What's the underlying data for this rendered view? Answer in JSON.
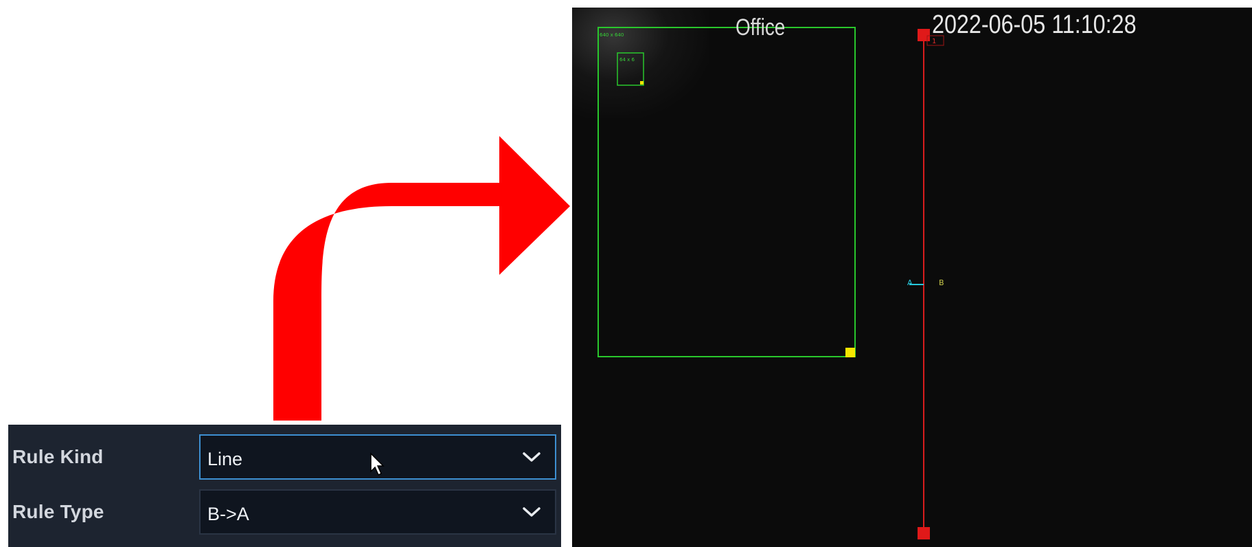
{
  "settings": {
    "rule_kind": {
      "label": "Rule Kind",
      "value": "Line"
    },
    "rule_type": {
      "label": "Rule Type",
      "value": "B->A"
    }
  },
  "camera": {
    "name": "Office",
    "timestamp": "2022-06-05 11:10:28",
    "max_box_label": "640 x 640",
    "min_box_label": "64 x 6",
    "line_label": "1",
    "side_a_label": "A",
    "side_b_label": "B"
  },
  "colors": {
    "arrow": "#ff0000",
    "detection_box": "#29c72c",
    "box_handle": "#f5e600",
    "rule_line": "#d91c1c",
    "focus_border": "#3d8fd1"
  },
  "icons": {
    "dropdown": "chevron-down-icon",
    "cursor": "mouse-pointer-icon",
    "annotation": "curved-arrow-icon"
  }
}
